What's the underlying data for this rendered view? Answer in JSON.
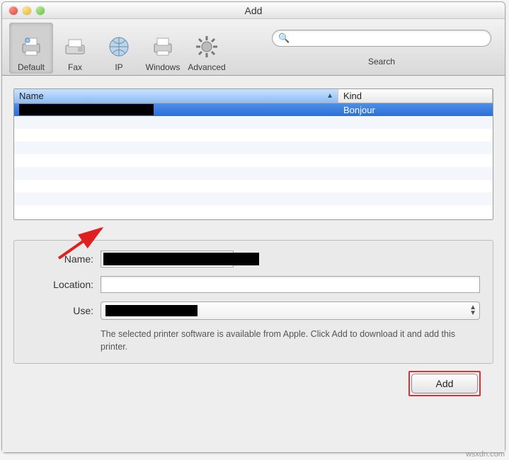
{
  "window": {
    "title": "Add"
  },
  "toolbar": {
    "items": [
      {
        "label": "Default"
      },
      {
        "label": "Fax"
      },
      {
        "label": "IP"
      },
      {
        "label": "Windows"
      },
      {
        "label": "Advanced"
      }
    ],
    "search": {
      "placeholder": "",
      "label": "Search"
    }
  },
  "list": {
    "columns": {
      "name": "Name",
      "kind": "Kind"
    },
    "rows": [
      {
        "name": "",
        "kind": "Bonjour"
      }
    ]
  },
  "form": {
    "name_label": "Name:",
    "name_value": "",
    "location_label": "Location:",
    "location_value": "",
    "use_label": "Use:",
    "use_value": "",
    "hint": "The selected printer software is available from Apple. Click Add to download it and add this printer."
  },
  "footer": {
    "add_label": "Add"
  },
  "watermark": "wsxdn.com"
}
